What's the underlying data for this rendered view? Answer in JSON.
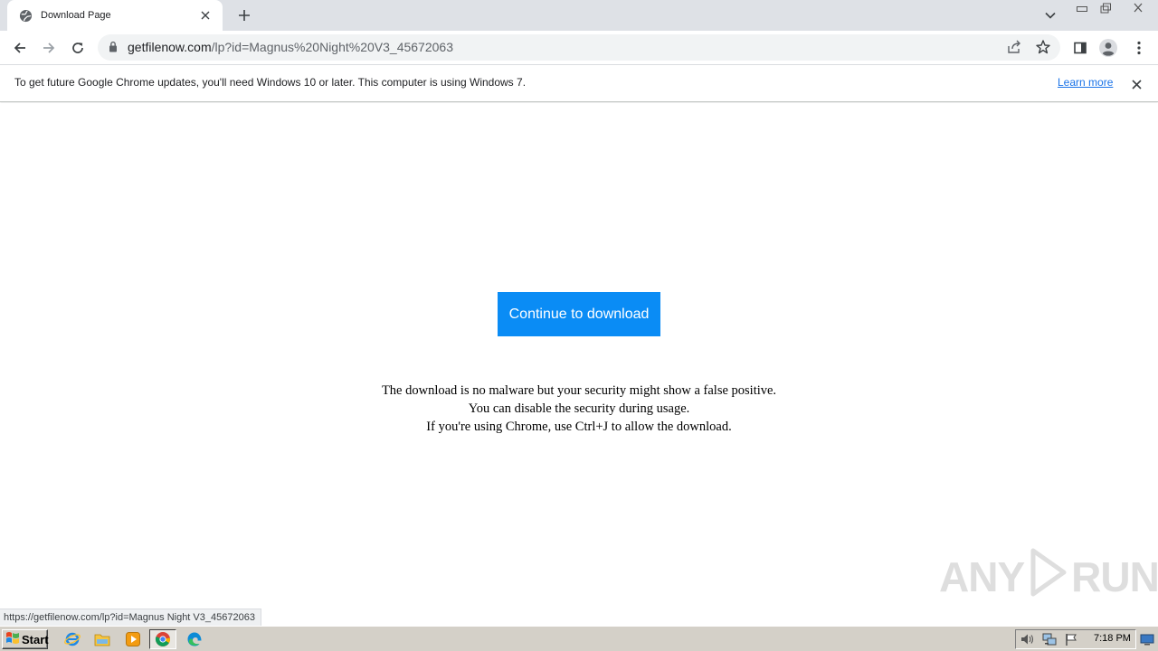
{
  "browser": {
    "tab": {
      "title": "Download Page"
    },
    "address": {
      "host": "getfilenow.com",
      "path": "/lp?id=Magnus%20Night%20V3_45672063"
    },
    "infobar": {
      "message": "To get future Google Chrome updates, you'll need Windows 10 or later. This computer is using Windows 7.",
      "learn_more": "Learn more"
    },
    "status_url": "https://getfilenow.com/lp?id=Magnus Night V3_45672063"
  },
  "page": {
    "download_button": "Continue to download",
    "notice_lines": [
      "The download is no malware but your security might show a false positive.",
      "You can disable the security during usage.",
      "If you're using Chrome, use Ctrl+J to allow the download."
    ]
  },
  "watermark": {
    "left": "ANY",
    "right": "RUN"
  },
  "taskbar": {
    "start_label": "Start",
    "clock": "7:18 PM"
  },
  "colors": {
    "button_bg": "#0a8cf5",
    "link": "#1a73e8",
    "tabstrip": "#dee1e6",
    "taskbar": "#d4d0c8"
  }
}
